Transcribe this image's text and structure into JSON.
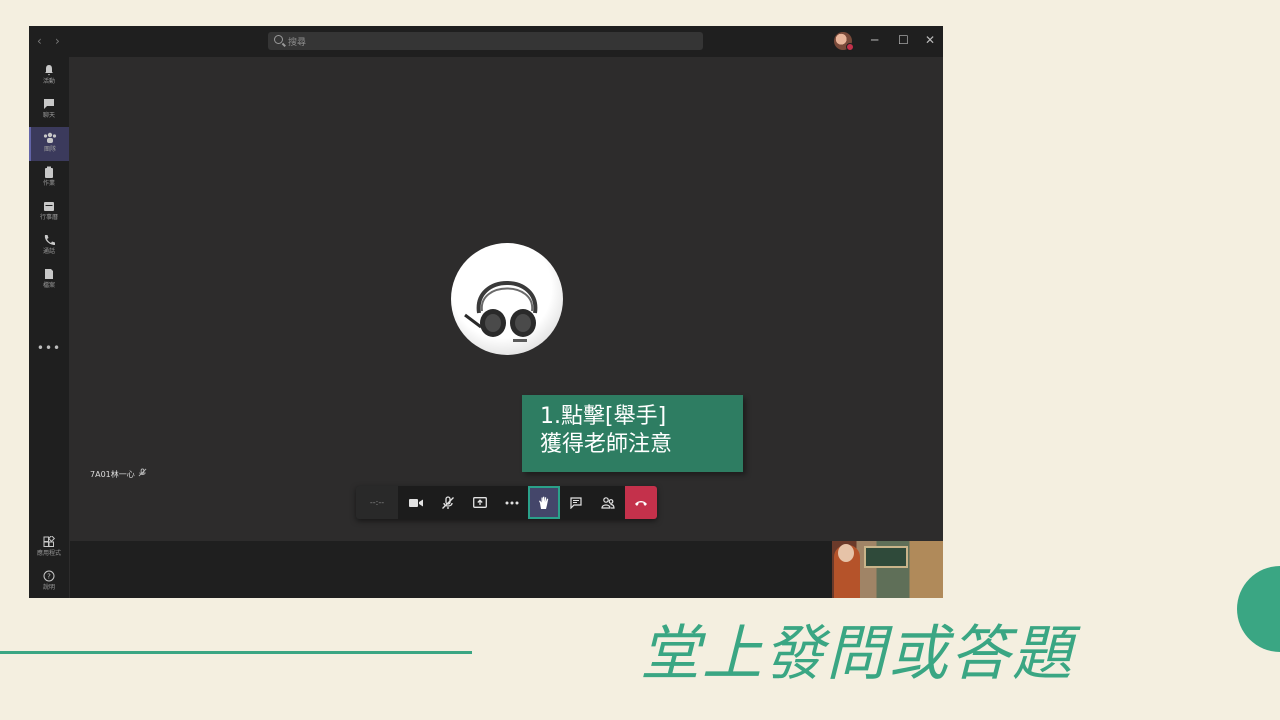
{
  "window": {
    "search_placeholder": "搜尋",
    "nav": {
      "back": "‹",
      "forward": "›"
    },
    "controls": {
      "minimize": "─",
      "maximize": "☐",
      "close": "✕"
    }
  },
  "rail": {
    "items": [
      {
        "label": "活動",
        "icon": "bell-icon"
      },
      {
        "label": "聊天",
        "icon": "chat-icon"
      },
      {
        "label": "團隊",
        "icon": "teams-icon",
        "active": true
      },
      {
        "label": "作業",
        "icon": "assignments-icon"
      },
      {
        "label": "行事曆",
        "icon": "calendar-icon"
      },
      {
        "label": "通話",
        "icon": "phone-icon"
      },
      {
        "label": "檔案",
        "icon": "files-icon"
      }
    ],
    "more": "•••",
    "bottom_items": [
      {
        "label": "應用程式",
        "icon": "apps-icon"
      },
      {
        "label": "說明",
        "icon": "help-icon"
      }
    ]
  },
  "meeting": {
    "participant_name": "7A01林一心",
    "timer": "--:--",
    "toolbar_icons": [
      "camera-icon",
      "mic-off-icon",
      "share-screen-icon",
      "more-icon",
      "raise-hand-icon",
      "chat-icon",
      "participants-icon",
      "hang-up-icon"
    ]
  },
  "callout": {
    "line1": "1.點擊[舉手]",
    "line2": "獲得老師注意"
  },
  "slide": {
    "title": "堂上發問或答題"
  },
  "colors": {
    "slide_background": "#f4efe0",
    "accent_green": "#3aa683",
    "callout_green": "#2e7d62",
    "teams_purple": "#6264a7",
    "hangup_red": "#c4314b"
  }
}
